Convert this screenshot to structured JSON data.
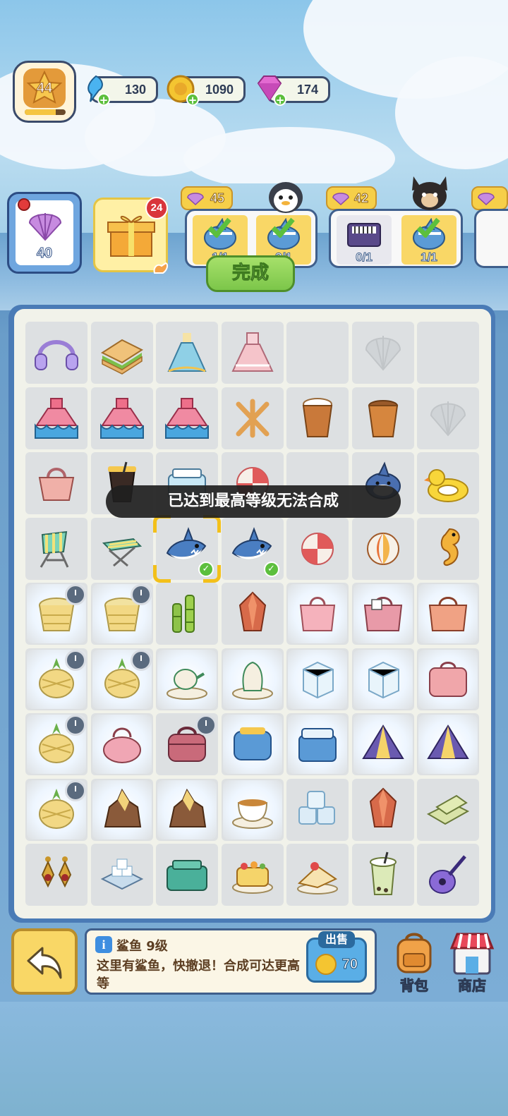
{
  "player": {
    "level": "44",
    "level_progress": 0.75
  },
  "resources": [
    {
      "name": "energy",
      "icon": "energy-icon",
      "value": "130"
    },
    {
      "name": "coins",
      "icon": "coin-icon",
      "value": "1090"
    },
    {
      "name": "gems",
      "icon": "gem-icon",
      "value": "174"
    }
  ],
  "shells": {
    "count": "40"
  },
  "gift": {
    "badge": "24"
  },
  "orders": [
    {
      "reward": "45",
      "items": [
        {
          "icon": "shark-plush-icon",
          "count": "1/1"
        },
        {
          "icon": "shark-plush-icon",
          "count": "2/1"
        }
      ]
    },
    {
      "reward": "42",
      "items": [
        {
          "icon": "accordion-icon",
          "count": "0/1"
        },
        {
          "icon": "shark-plush-icon",
          "count": "1/1"
        }
      ]
    }
  ],
  "done_label": "完成",
  "toast": "已达到最高等级无法合成",
  "board": [
    [
      "headphones-icon",
      "sandwich-icon",
      "blue-dress-icon",
      "pink-dress-icon",
      "empty",
      "shell-placeholder-icon",
      "empty"
    ],
    [
      "ruffle-dress-icon",
      "ruffle-dress-icon",
      "ruffle-dress-icon",
      "wood-sticks-icon",
      "coffee-cup-icon",
      "tea-cup-icon",
      "shell-placeholder-icon"
    ],
    [
      "handbag-icon",
      "iced-coffee-icon",
      "ice-box-icon",
      "peppermint-candy-icon",
      "empty",
      "shark-plush-icon",
      "rubber-duck-icon"
    ],
    [
      "beach-chair-icon",
      "beach-stool-icon",
      "shark-icon",
      "shark-icon",
      "peppermint-candy-icon",
      "beach-ball-icon",
      "seahorse-icon"
    ],
    [
      "straw-basket-icon",
      "straw-basket-icon",
      "bamboo-icon",
      "crystal-icon",
      "shopping-bag-icon",
      "tote-bag-icon",
      "orange-bag-icon"
    ],
    [
      "pineapple-basket-icon",
      "pineapple-basket-icon",
      "teapot-set-icon",
      "tea-set-icon",
      "ice-cube-icon",
      "ice-cube-icon",
      "pink-case-icon"
    ],
    [
      "pineapple-basket-icon",
      "pink-purse-icon",
      "travel-bag-icon",
      "toaster-icon",
      "ice-chest-icon",
      "tent-icon",
      "tent-icon"
    ],
    [
      "pineapple-basket-icon",
      "crystal-rock-icon",
      "crystal-rock-icon",
      "teacup-icon",
      "ice-cubes-icon",
      "crystal-icon",
      "bamboo-mat-icon"
    ],
    [
      "earrings-icon",
      "ice-tray-icon",
      "green-case-icon",
      "fruit-cake-icon",
      "strawberry-cake-icon",
      "bubble-tea-icon",
      "guitar-icon"
    ]
  ],
  "info": {
    "title": "鲨鱼  9级",
    "desc": "这里有鲨鱼，快撤退！合成可达更高等",
    "sell_label": "出售",
    "sell_price": "70"
  },
  "backpack_label": "背包",
  "shop_label": "商店",
  "colors": {
    "accent_green": "#7cc64a",
    "frame_blue": "#4a7bb6",
    "gold": "#f9d766"
  }
}
